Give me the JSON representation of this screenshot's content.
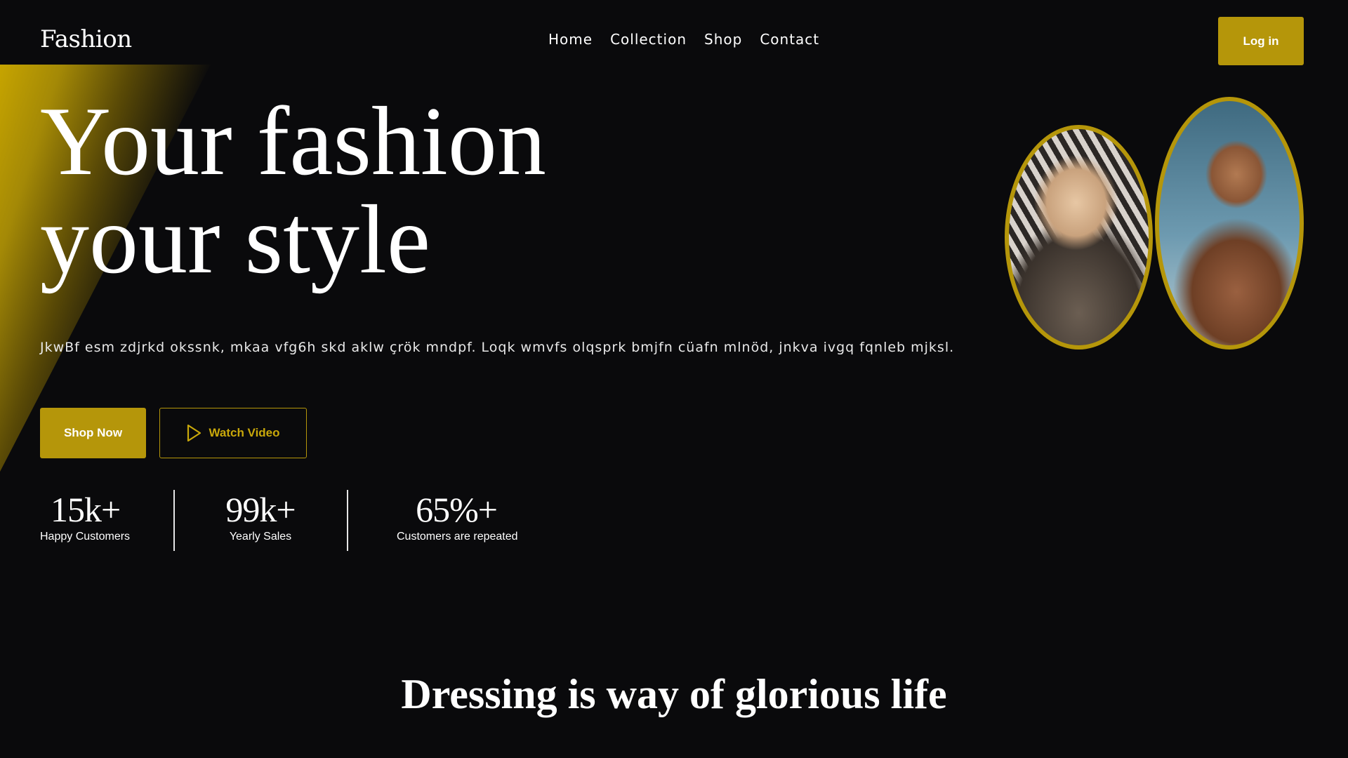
{
  "header": {
    "brand": "Fashion",
    "nav": [
      "Home",
      "Collection",
      "Shop",
      "Contact"
    ],
    "login_label": "Log in"
  },
  "hero": {
    "title_line1": "Your fashion",
    "title_line2": "your style",
    "description": "JkwBf esm zdjrkd okssnk, mkaa vfg6h skd aklw çrök mndpf. Loqk wmvfs olqsprk bmjfn cüafn mlnöd, jnkva ivgq fqnleb mjksl.",
    "shop_label": "Shop Now",
    "video_label": "Watch Video"
  },
  "stats": [
    {
      "value": "15k+",
      "label": "Happy Customers"
    },
    {
      "value": "99k+",
      "label": "Yearly Sales"
    },
    {
      "value": "65%+",
      "label": "Customers are repeated"
    }
  ],
  "slogan": "Dressing is way of glorious life",
  "colors": {
    "accent": "#b5960a",
    "background": "#0a0a0c",
    "text": "#ffffff"
  },
  "icons": {
    "play": "play-icon"
  }
}
